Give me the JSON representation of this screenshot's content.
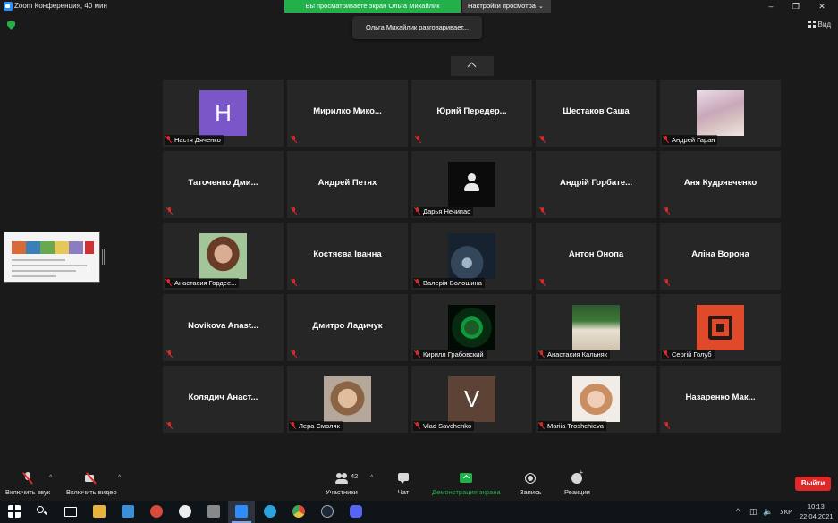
{
  "window": {
    "title": "Zoom Конференция, 40 мин",
    "share_banner": "Вы просматриваете экран Ольга Михайлик",
    "view_options": "Настройки просмотра",
    "view_button": "Вид"
  },
  "speaking_toast": "Ольга Михайлик разговаривает...",
  "tiles": [
    {
      "name": "Настя Дяченко",
      "big": "",
      "avatar": "H"
    },
    {
      "name": "",
      "big": "Мирилко  Мико..."
    },
    {
      "name": "",
      "big": "Юрий  Передер..."
    },
    {
      "name": "",
      "big": "Шестаков Саша"
    },
    {
      "name": "Андрей Гаран",
      "big": ""
    },
    {
      "name": "",
      "big": "Таточенко  Дми..."
    },
    {
      "name": "",
      "big": "Андрей Петях"
    },
    {
      "name": "Дарья Нечипас",
      "big": ""
    },
    {
      "name": "",
      "big": "Андрій  Горбате..."
    },
    {
      "name": "",
      "big": "Аня Кудрявченко"
    },
    {
      "name": "Анастасия Гордее...",
      "big": ""
    },
    {
      "name": "",
      "big": "Костяєва Іванна"
    },
    {
      "name": "Валерія Волошина",
      "big": ""
    },
    {
      "name": "",
      "big": "Антон Онопа"
    },
    {
      "name": "",
      "big": "Аліна Ворона"
    },
    {
      "name": "",
      "big": "Novikova  Anast..."
    },
    {
      "name": "",
      "big": "Дмитро Ладичук"
    },
    {
      "name": "Кирилл Грабовский",
      "big": ""
    },
    {
      "name": "Анастасия Кальняк",
      "big": ""
    },
    {
      "name": "Сергій Голуб",
      "big": ""
    },
    {
      "name": "",
      "big": "Колядич  Анаст..."
    },
    {
      "name": "Лера Смоляк",
      "big": ""
    },
    {
      "name": "Vlad Savchenko",
      "big": "",
      "avatar": "V"
    },
    {
      "name": "Mariia Troshchieva",
      "big": ""
    },
    {
      "name": "",
      "big": "Назаренко  Мак..."
    }
  ],
  "controls": {
    "audio": "Включить звук",
    "video": "Включить видео",
    "participants": "Участники",
    "participants_count": "42",
    "chat": "Чат",
    "share": "Демонстрация экрана",
    "record": "Запись",
    "reactions": "Реакции",
    "leave": "Выйти"
  },
  "taskbar": {
    "language": "УКР",
    "time": "10:13",
    "date": "22.04.2021"
  },
  "colors": {
    "accent_green": "#23b04b",
    "leave_red": "#e02828",
    "tile_bg": "#262626"
  }
}
